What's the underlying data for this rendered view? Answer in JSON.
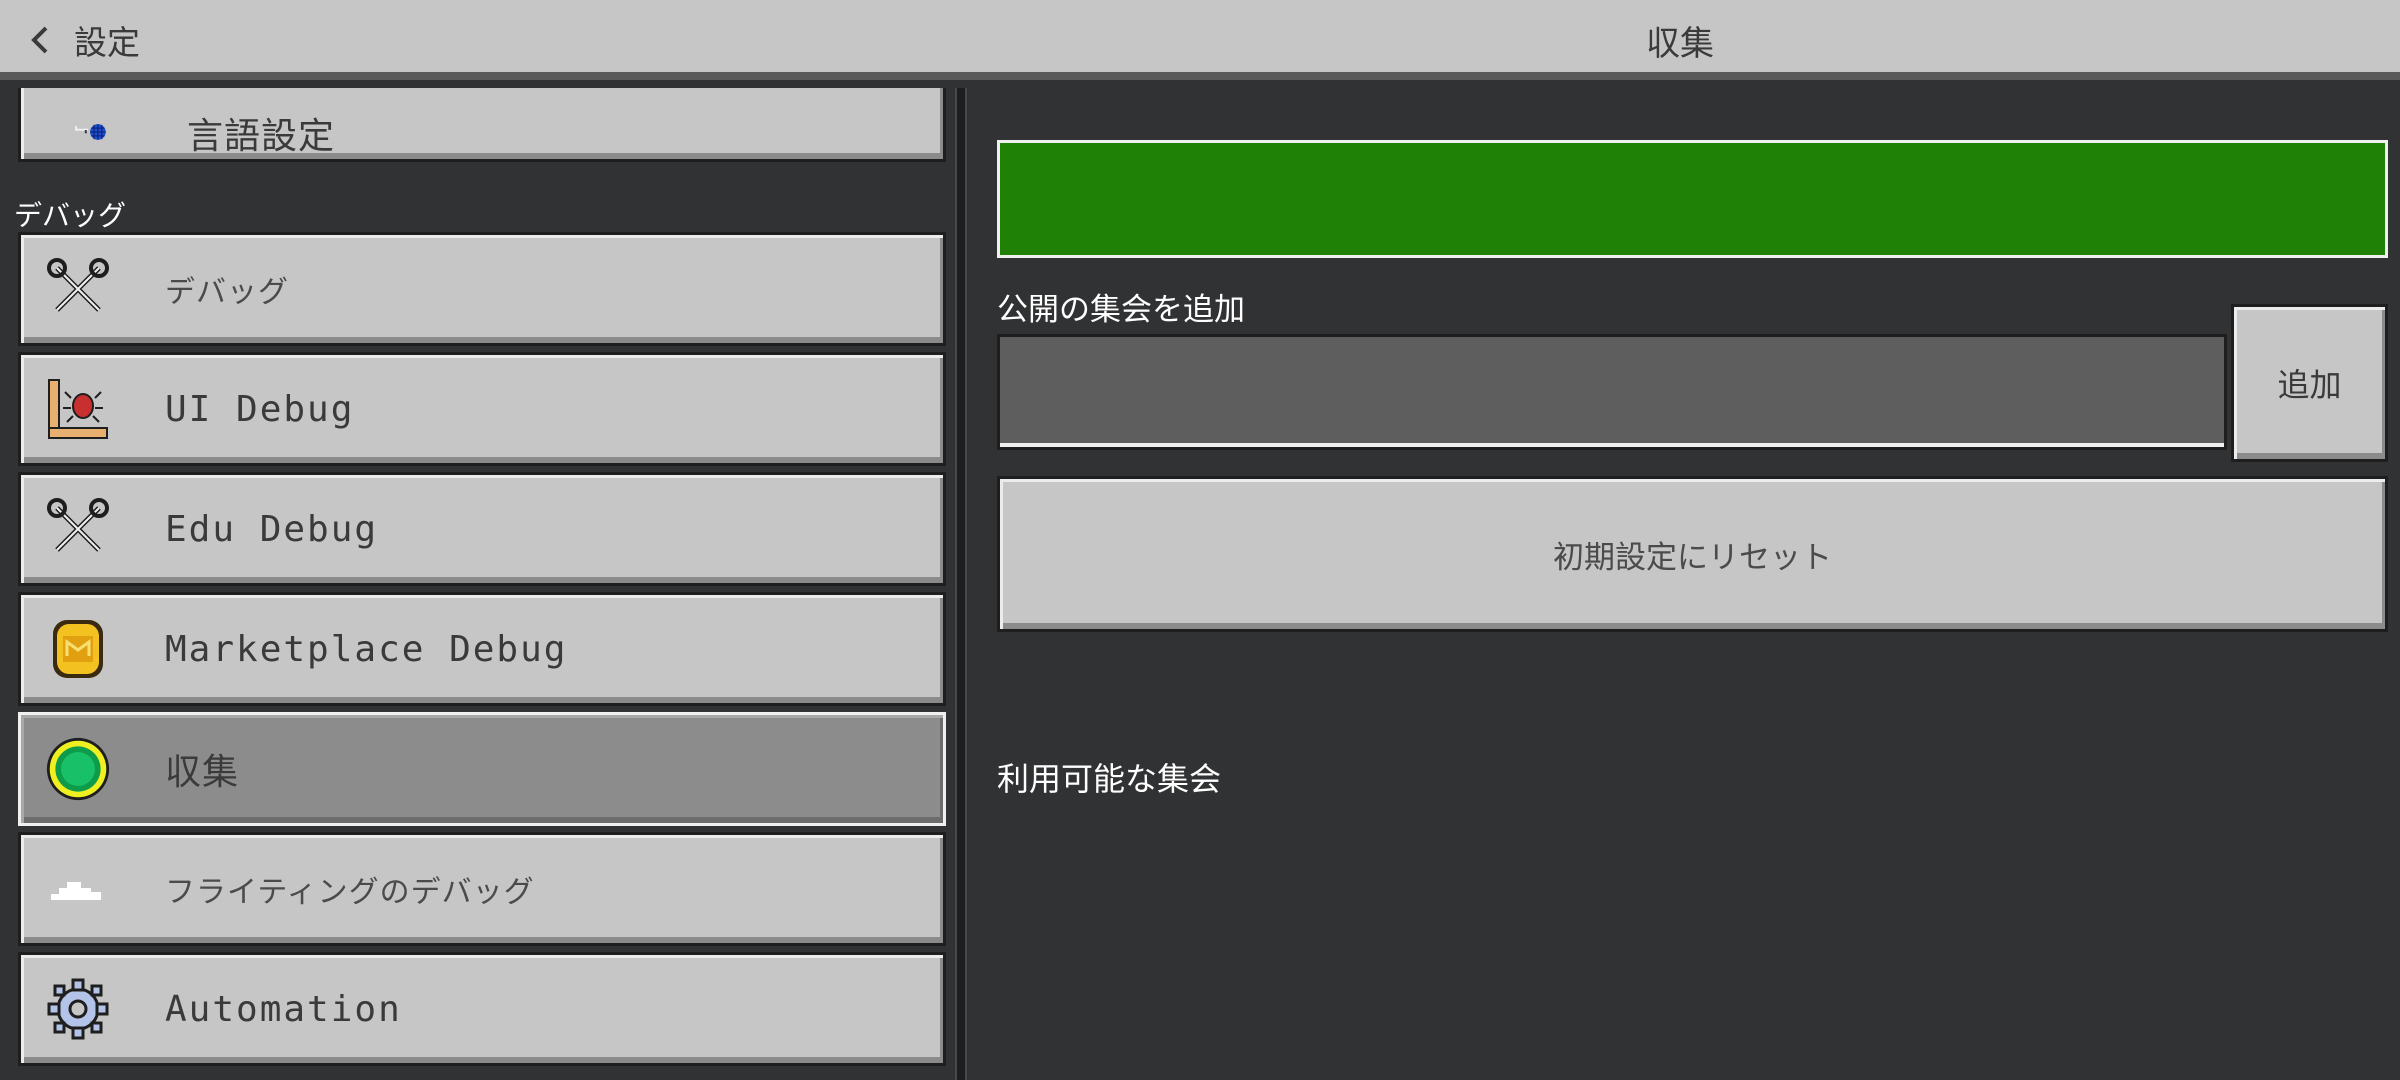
{
  "header": {
    "back_label": "設定",
    "title": "収集"
  },
  "sidebar": {
    "partial_item": {
      "label": "言語設定",
      "icon": "globe-key-icon"
    },
    "section_label": "デバッグ",
    "items": [
      {
        "label": "デバッグ",
        "icon": "tools-icon"
      },
      {
        "label": "UI Debug",
        "icon": "ui-debug-icon"
      },
      {
        "label": "Edu Debug",
        "icon": "tools-icon"
      },
      {
        "label": "Marketplace Debug",
        "icon": "minecoin-icon"
      },
      {
        "label": "収集",
        "icon": "green-gem-icon",
        "selected": true
      },
      {
        "label": "フライティングのデバッグ",
        "icon": "cloud-icon"
      },
      {
        "label": "Automation",
        "icon": "gear-icon"
      }
    ]
  },
  "main": {
    "progress": 1.0,
    "add_public_label": "公開の集会を追加",
    "input_value": "",
    "add_button": "追加",
    "reset_button": "初期設定にリセット",
    "available_label": "利用可能な集会"
  },
  "colors": {
    "panel_bg": "#313233",
    "button_bg": "#c6c6c6",
    "selected_bg": "#8c8c8c",
    "progress_green": "#1f8206"
  }
}
